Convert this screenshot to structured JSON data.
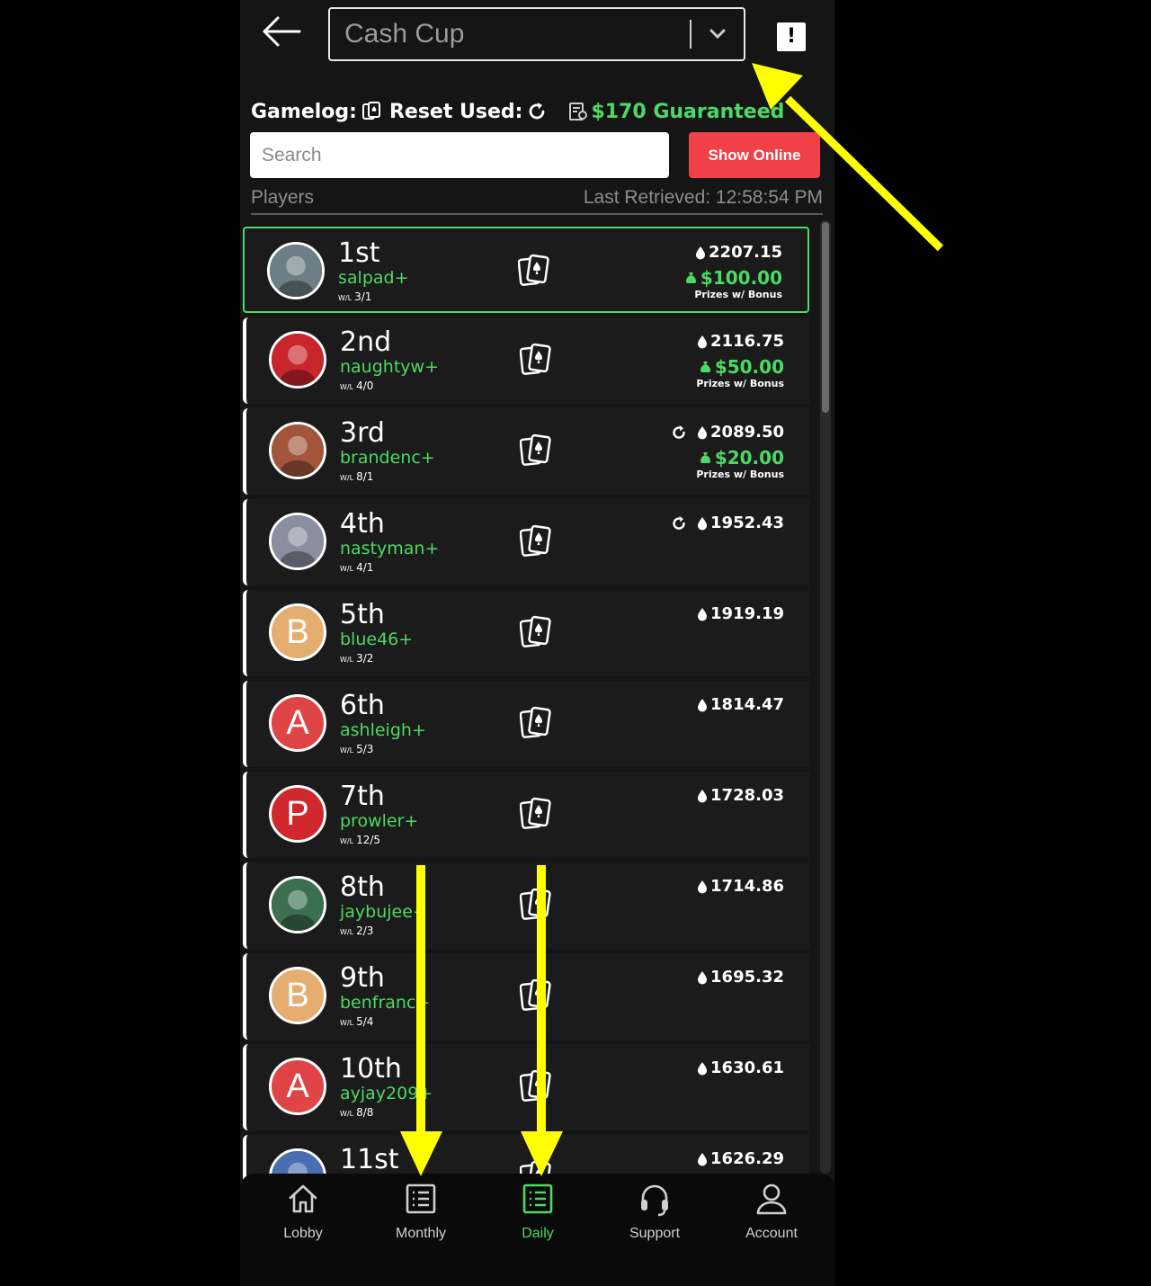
{
  "header": {
    "tournament": "Cash Cup"
  },
  "info": {
    "gamelog_label": "Gamelog:",
    "reset_label": "Reset Used:",
    "guaranteed": "$170 Guaranteed"
  },
  "search": {
    "placeholder": "Search",
    "value": ""
  },
  "show_online_label": "Show Online",
  "list_header": {
    "players": "Players",
    "last_retrieved": "Last Retrieved: 12:58:54 PM"
  },
  "players": [
    {
      "rank": "1st",
      "user": "salpad+",
      "wl": "3/1",
      "points": "2207.15",
      "prize": "$100.00",
      "prize_note": "Prizes w/ Bonus",
      "reset": false,
      "avatar": "photo-goblin",
      "avatar_color": "#6d7f86"
    },
    {
      "rank": "2nd",
      "user": "naughtyw+",
      "wl": "4/0",
      "points": "2116.75",
      "prize": "$50.00",
      "prize_note": "Prizes w/ Bonus",
      "reset": false,
      "avatar": "photo-red",
      "avatar_color": "#c8262c"
    },
    {
      "rank": "3rd",
      "user": "brandenc+",
      "wl": "8/1",
      "points": "2089.50",
      "prize": "$20.00",
      "prize_note": "Prizes w/ Bonus",
      "reset": true,
      "avatar": "photo-car",
      "avatar_color": "#a2553a"
    },
    {
      "rank": "4th",
      "user": "nastyman+",
      "wl": "4/1",
      "points": "1952.43",
      "prize": "",
      "prize_note": "",
      "reset": true,
      "avatar": "photo-person",
      "avatar_color": "#8a8fa0"
    },
    {
      "rank": "5th",
      "user": "blue46+",
      "wl": "3/2",
      "points": "1919.19",
      "prize": "",
      "prize_note": "",
      "reset": false,
      "avatar": "B",
      "avatar_color": "#e5ae70"
    },
    {
      "rank": "6th",
      "user": "ashleigh+",
      "wl": "5/3",
      "points": "1814.47",
      "prize": "",
      "prize_note": "",
      "reset": false,
      "avatar": "A",
      "avatar_color": "#df4446"
    },
    {
      "rank": "7th",
      "user": "prowler+",
      "wl": "12/5",
      "points": "1728.03",
      "prize": "",
      "prize_note": "",
      "reset": false,
      "avatar": "P",
      "avatar_color": "#d0282c"
    },
    {
      "rank": "8th",
      "user": "jaybujee+",
      "wl": "2/3",
      "points": "1714.86",
      "prize": "",
      "prize_note": "",
      "reset": false,
      "avatar": "photo-pool",
      "avatar_color": "#3b6f4f"
    },
    {
      "rank": "9th",
      "user": "benfranc+",
      "wl": "5/4",
      "points": "1695.32",
      "prize": "",
      "prize_note": "",
      "reset": false,
      "avatar": "B",
      "avatar_color": "#e5ae70"
    },
    {
      "rank": "10th",
      "user": "ayjay209+",
      "wl": "8/8",
      "points": "1630.61",
      "prize": "",
      "prize_note": "",
      "reset": false,
      "avatar": "A",
      "avatar_color": "#df4446"
    },
    {
      "rank": "11st",
      "user": "",
      "wl": "",
      "points": "1626.29",
      "prize": "",
      "prize_note": "",
      "reset": false,
      "avatar": "photo-pink",
      "avatar_color": "#4a6fb0"
    }
  ],
  "wl_prefix": "W/L",
  "nav": [
    {
      "label": "Lobby",
      "icon": "home-icon",
      "active": false
    },
    {
      "label": "Monthly",
      "icon": "list-icon",
      "active": false
    },
    {
      "label": "Daily",
      "icon": "list-icon",
      "active": true
    },
    {
      "label": "Support",
      "icon": "headset-icon",
      "active": false
    },
    {
      "label": "Account",
      "icon": "person-icon",
      "active": false
    }
  ],
  "colors": {
    "accent_green": "#4cd964",
    "show_online_red": "#f04048",
    "annotation_yellow": "#ffff00"
  }
}
